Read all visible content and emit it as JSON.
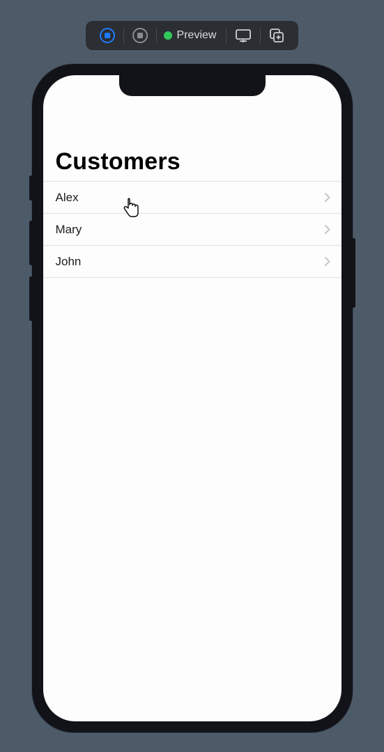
{
  "toolbar": {
    "preview_label": "Preview"
  },
  "app": {
    "title": "Customers",
    "customers": [
      {
        "name": "Alex"
      },
      {
        "name": "Mary"
      },
      {
        "name": "John"
      }
    ]
  }
}
